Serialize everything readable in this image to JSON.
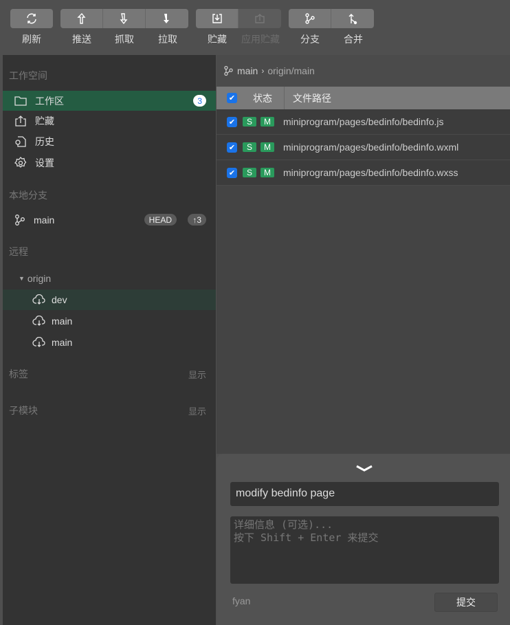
{
  "toolbar": {
    "refresh": "刷新",
    "push": "推送",
    "fetch": "抓取",
    "pull": "拉取",
    "stash": "贮藏",
    "apply_stash": "应用贮藏",
    "branch": "分支",
    "merge": "合并"
  },
  "sidebar": {
    "workspace_title": "工作空间",
    "workspace_items": [
      {
        "label": "工作区",
        "badge": "3",
        "icon": "folder-icon"
      },
      {
        "label": "贮藏",
        "icon": "stash-icon"
      },
      {
        "label": "历史",
        "icon": "history-icon"
      },
      {
        "label": "设置",
        "icon": "gear-icon"
      }
    ],
    "local_title": "本地分支",
    "local_branch": {
      "label": "main",
      "head": "HEAD",
      "ahead": "↑3"
    },
    "remote_title": "远程",
    "remote_name": "origin",
    "remote_branches": [
      "dev",
      "main",
      "main"
    ],
    "tags_title": "标签",
    "tags_show": "显示",
    "submodules_title": "子模块",
    "submodules_show": "显示"
  },
  "main": {
    "breadcrumb": {
      "local": "main",
      "remote": "origin/main"
    },
    "headers": {
      "status": "状态",
      "path": "文件路径"
    },
    "files": [
      {
        "staged": "S",
        "status": "M",
        "path": "miniprogram/pages/bedinfo/bedinfo.js",
        "checked": true
      },
      {
        "staged": "S",
        "status": "M",
        "path": "miniprogram/pages/bedinfo/bedinfo.wxml",
        "checked": true
      },
      {
        "staged": "S",
        "status": "M",
        "path": "miniprogram/pages/bedinfo/bedinfo.wxss",
        "checked": true
      }
    ]
  },
  "commit": {
    "summary": "modify bedinfo page",
    "description_placeholder": "详细信息 (可选)...\n按下 Shift + Enter 来提交",
    "author": "fyan",
    "submit": "提交"
  },
  "colors": {
    "active": "#245c42",
    "checkbox": "#1a73e8",
    "tag": "#2a9a5c"
  }
}
